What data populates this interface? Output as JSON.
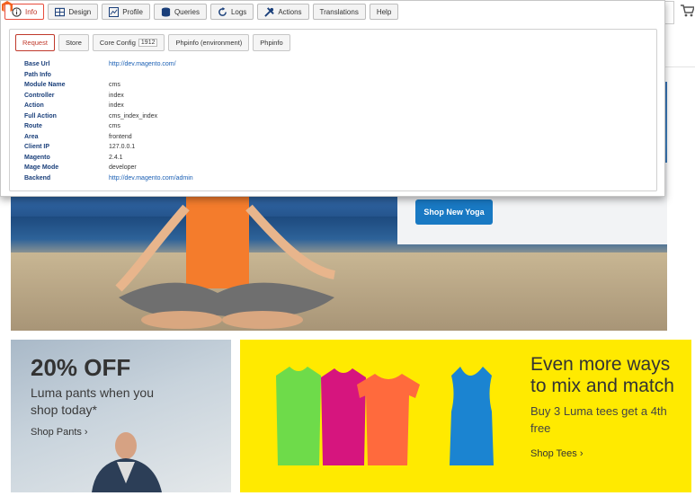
{
  "toolbar": {
    "tabs": [
      {
        "label": "Info",
        "icon": "info-icon"
      },
      {
        "label": "Design",
        "icon": "grid-icon"
      },
      {
        "label": "Profile",
        "icon": "chart-icon"
      },
      {
        "label": "Queries",
        "icon": "database-icon"
      },
      {
        "label": "Logs",
        "icon": "refresh-icon"
      },
      {
        "label": "Actions",
        "icon": "tools-icon"
      },
      {
        "label": "Translations"
      },
      {
        "label": "Help"
      }
    ],
    "active_tab": "Info",
    "accent_color": "#e74c3c"
  },
  "info": {
    "subtabs": [
      {
        "label": "Request"
      },
      {
        "label": "Store"
      },
      {
        "label": "Core Config",
        "badge": "1912"
      },
      {
        "label": "Phpinfo (environment)"
      },
      {
        "label": "Phpinfo"
      }
    ],
    "active_subtab": "Request",
    "rows": [
      {
        "key": "Base Url",
        "value": "http://dev.magento.com/",
        "link": true
      },
      {
        "key": "Path Info",
        "value": ""
      },
      {
        "key": "Module Name",
        "value": "cms"
      },
      {
        "key": "Controller",
        "value": "index"
      },
      {
        "key": "Action",
        "value": "index"
      },
      {
        "key": "Full Action",
        "value": "cms_index_index"
      },
      {
        "key": "Route",
        "value": "cms"
      },
      {
        "key": "Area",
        "value": "frontend"
      },
      {
        "key": "Client IP",
        "value": "127.0.0.1"
      },
      {
        "key": "Magento",
        "value": "2.4.1"
      },
      {
        "key": "Mage Mode",
        "value": "developer"
      },
      {
        "key": "Backend",
        "value": "http://dev.magento.com/admin",
        "link": true
      }
    ]
  },
  "store": {
    "hero": {
      "button_label": "Shop New Yoga",
      "button_color": "#1979c3"
    },
    "pants_tile": {
      "headline": "20% OFF",
      "subtitle": "Luma pants when you shop today*",
      "link": "Shop Pants ›"
    },
    "tees_tile": {
      "headline": "Even more ways to mix and match",
      "subtitle": "Buy 3 Luma tees get a 4th free",
      "link": "Shop Tees ›",
      "background": "#ffea00"
    }
  }
}
